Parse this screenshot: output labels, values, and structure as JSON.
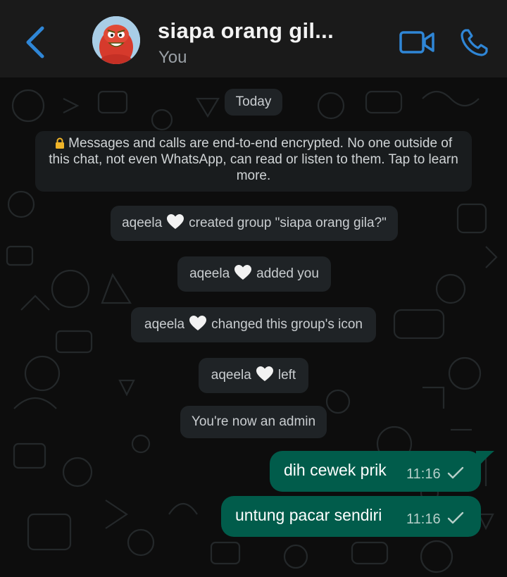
{
  "header": {
    "title": "siapa orang gil...",
    "subtitle": "You",
    "accent_color": "#2f86d6",
    "icons": [
      "back-arrow-icon",
      "group-avatar",
      "video-call-icon",
      "voice-call-icon"
    ]
  },
  "chat": {
    "day_label": "Today",
    "encryption_notice": "Messages and calls are end-to-end encrypted. No one outside of this chat, not even WhatsApp, can read or listen to them. Tap to learn more.",
    "encryption_line1": "Messages and calls are end-to-end encrypted. No one outside of",
    "encryption_line2": "this chat, not even WhatsApp, can read or listen to them. Tap to learn",
    "encryption_line3": "more.",
    "system_messages": [
      {
        "user": "aqeela",
        "action": "created group \"siapa orang gila?\""
      },
      {
        "user": "aqeela",
        "action": "added you"
      },
      {
        "user": "aqeela",
        "action": "changed this group's icon"
      },
      {
        "user": "aqeela",
        "action": "left"
      },
      {
        "text": "You're now an admin"
      }
    ],
    "outgoing_messages": [
      {
        "text": "dih cewek prik",
        "time": "11:16",
        "status": "sent"
      },
      {
        "text": "untung pacar sendiri",
        "time": "11:16",
        "status": "sent"
      }
    ],
    "bubble_color": "#015c4b"
  }
}
